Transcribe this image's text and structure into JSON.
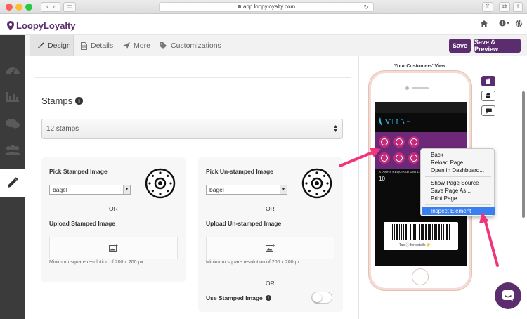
{
  "browser": {
    "url": "app.loopyloyalty.com"
  },
  "app": {
    "brand": "LoopyLoyalty",
    "brand_color": "#5c2d6e"
  },
  "tabs": [
    {
      "label": "Design",
      "icon": "brush-icon",
      "active": true
    },
    {
      "label": "Details",
      "icon": "document-icon",
      "active": false
    },
    {
      "label": "More",
      "icon": "paper-plane-icon",
      "active": false
    },
    {
      "label": "Customizations",
      "icon": "tag-icon",
      "active": false
    }
  ],
  "toolbar": {
    "save_label": "Save",
    "save_preview_label": "Save & Preview"
  },
  "sidebar": {
    "items": [
      "dashboard-icon",
      "chart-icon",
      "chat-icon",
      "users-icon",
      "pencil-icon"
    ],
    "active_index": 4
  },
  "form": {
    "section_title": "Stamps",
    "stamps_select": "12 stamps",
    "stamped": {
      "pick_label": "Pick Stamped Image",
      "selected": "bagel",
      "or": "OR",
      "upload_label": "Upload Stamped Image",
      "hint": "Minimum square resolution of 200 x 200 px"
    },
    "unstamped": {
      "pick_label": "Pick Un-stamped Image",
      "selected": "bagel",
      "or": "OR",
      "upload_label": "Upload Un-stamped Image",
      "hint": "Minimum square resolution of 200 x 200 px",
      "or2": "OR",
      "use_stamped_label": "Use Stamped Image",
      "use_stamped_on": false
    }
  },
  "preview": {
    "title": "Your Customers' View",
    "stamps_required_text": "STAMPS REQUIRED UNTIL N",
    "stamps_required_value": "10",
    "tap_text": "Tap ⓘ for details 👉",
    "side_buttons": [
      "apple-icon",
      "android-icon",
      "message-icon"
    ]
  },
  "context_menu": {
    "items": [
      "Back",
      "Reload Page",
      "Open in Dashboard...",
      "Show Page Source",
      "Save Page As...",
      "Print Page...",
      "Inspect Element"
    ],
    "highlighted": "Inspect Element"
  }
}
